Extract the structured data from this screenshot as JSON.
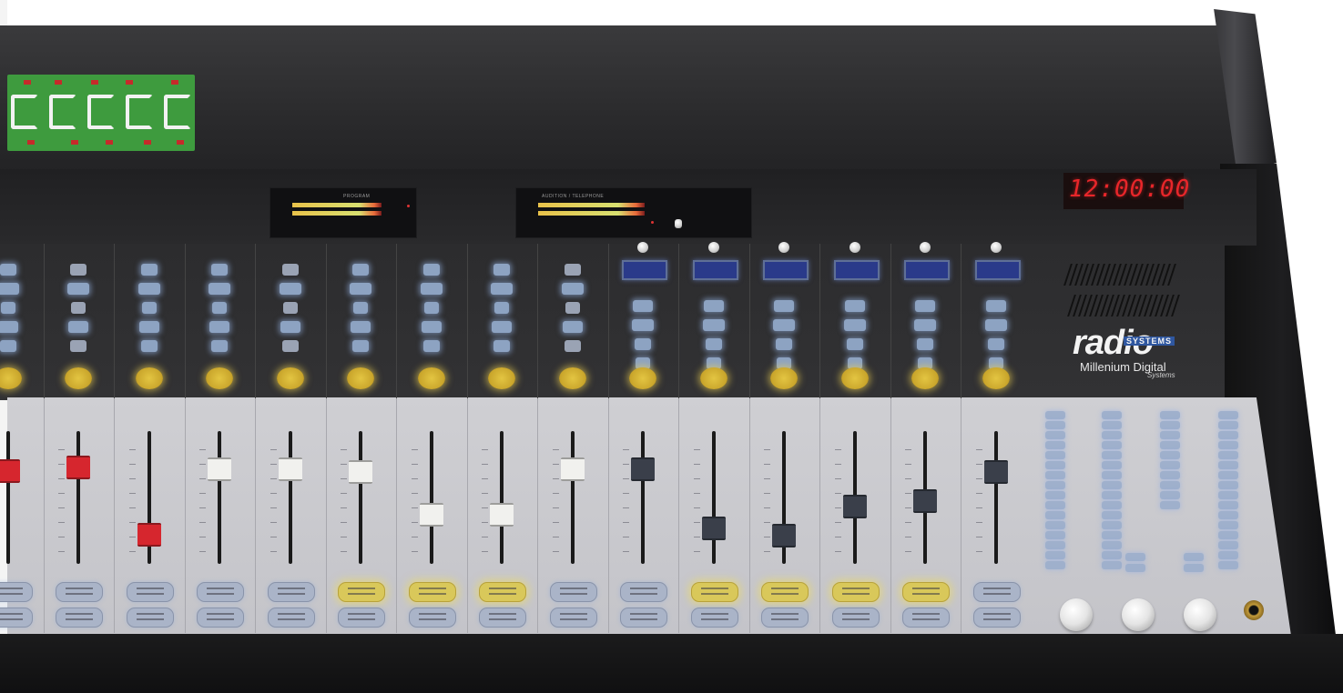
{
  "clock": {
    "time": "12:00:00"
  },
  "logo": {
    "word": "radio",
    "badge": "SYSTEMS",
    "model": "Millenium Digital",
    "maker": "Systems"
  },
  "meters": [
    {
      "label": "PROGRAM",
      "level": 0.82
    },
    {
      "label": "AUDITION / TELEPHONE",
      "level": 0.78
    }
  ],
  "channel_fader_levels": [
    0.85,
    0.88,
    0.37,
    0.86,
    0.86,
    0.84,
    0.52,
    0.52,
    0.86,
    0.86,
    0.42,
    0.36,
    0.58,
    0.62,
    0.84
  ],
  "channel_cap_colors": [
    "red",
    "red",
    "red",
    "white",
    "white",
    "white",
    "white",
    "white",
    "white",
    "dark",
    "dark",
    "dark",
    "dark",
    "dark",
    "dark"
  ],
  "colors": {
    "console_body": "#2b2b2d",
    "fader_panel": "#c8c8cd",
    "button_glow_blue": "#8da3c2",
    "button_glow_yellow": "#e3c542",
    "clock_led": "#e8262a",
    "circuit_board": "#3e9b3e"
  }
}
